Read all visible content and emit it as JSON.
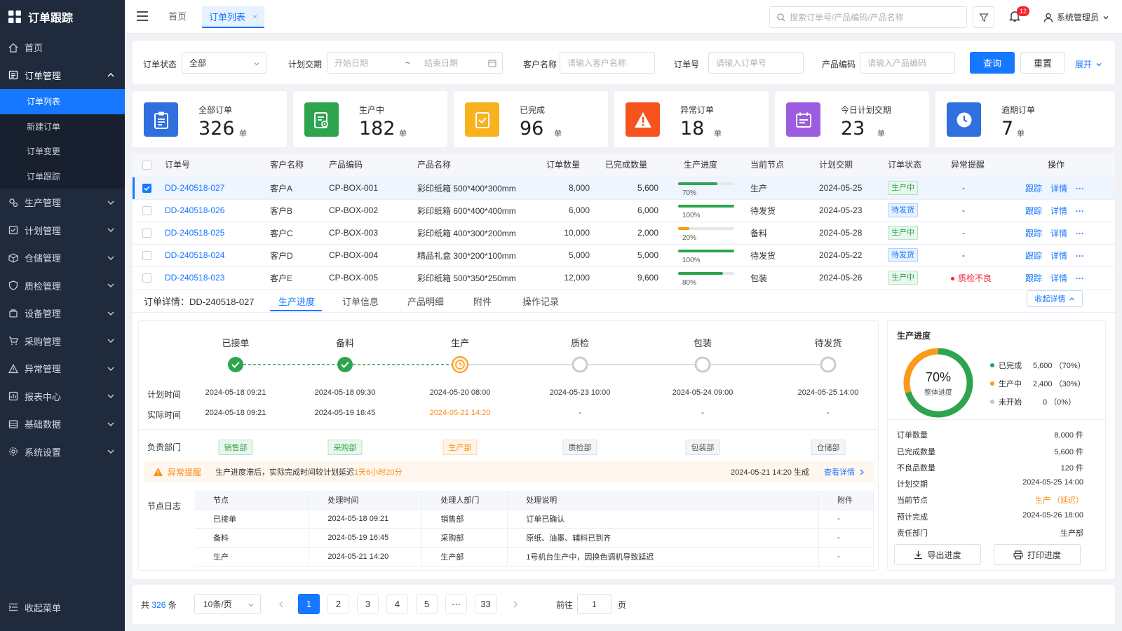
{
  "app": {
    "title": "订单跟踪",
    "collapse_menu": "收起菜单"
  },
  "sidebar": {
    "items": [
      {
        "label": "首页"
      },
      {
        "label": "订单管理"
      },
      {
        "label": "生产管理"
      },
      {
        "label": "计划管理"
      },
      {
        "label": "仓储管理"
      },
      {
        "label": "质检管理"
      },
      {
        "label": "设备管理"
      },
      {
        "label": "采购管理"
      },
      {
        "label": "异常管理"
      },
      {
        "label": "报表中心"
      },
      {
        "label": "基础数据"
      },
      {
        "label": "系统设置"
      }
    ],
    "subitems": [
      {
        "label": "订单列表"
      },
      {
        "label": "新建订单"
      },
      {
        "label": "订单变更"
      },
      {
        "label": "订单跟踪"
      }
    ]
  },
  "topbar": {
    "tab_home": "首页",
    "tab_active": "订单列表",
    "search_placeholder": "搜索订单号/产品编码/产品名称",
    "notif_count": "12",
    "user": "系统管理员"
  },
  "filters": {
    "status_label": "订单状态",
    "status_value": "全部",
    "date_label": "计划交期",
    "start_placeholder": "开始日期",
    "tilde": "~",
    "end_placeholder": "结束日期",
    "customer_label": "客户名称",
    "customer_placeholder": "请输入客户名称",
    "order_label": "订单号",
    "order_placeholder": "请输入订单号",
    "code_label": "产品编码",
    "code_placeholder": "请输入产品编码",
    "query": "查询",
    "reset": "重置",
    "expand": "展开"
  },
  "stats": [
    {
      "label": "全部订单",
      "value": "326",
      "unit": "单",
      "color": "#2f6fde"
    },
    {
      "label": "生产中",
      "value": "182",
      "unit": "单",
      "color": "#2ea44f"
    },
    {
      "label": "已完成",
      "value": "96",
      "unit": "单",
      "color": "#f7b21e"
    },
    {
      "label": "异常订单",
      "value": "18",
      "unit": "单",
      "color": "#f5541f"
    },
    {
      "label": "今日计划交期",
      "value": "23",
      "unit": "单",
      "color": "#9c5ce0"
    },
    {
      "label": "逾期订单",
      "value": "7",
      "unit": "单",
      "color": "#2f6fde"
    }
  ],
  "table": {
    "headers": [
      "订单号",
      "客户名称",
      "产品编码",
      "产品名称",
      "订单数量",
      "已完成数量",
      "生产进度",
      "当前节点",
      "计划交期",
      "订单状态",
      "异常提醒",
      "操作"
    ],
    "action_track": "跟踪",
    "action_detail": "详情",
    "action_more": "···",
    "rows": [
      {
        "id": "DD-240518-027",
        "customer": "客户A",
        "code": "CP-BOX-001",
        "name": "彩印纸箱 500*400*300mm",
        "qty": "8,000",
        "done": "5,600",
        "progress": 70,
        "progress_text": "70%",
        "node": "生产",
        "date": "2024-05-25",
        "status": "生产中",
        "alert": "-",
        "selected": true
      },
      {
        "id": "DD-240518-026",
        "customer": "客户B",
        "code": "CP-BOX-002",
        "name": "彩印纸箱 600*400*400mm",
        "qty": "6,000",
        "done": "6,000",
        "progress": 100,
        "progress_text": "100%",
        "node": "待发货",
        "date": "2024-05-23",
        "status": "待发货",
        "alert": "-",
        "selected": false
      },
      {
        "id": "DD-240518-025",
        "customer": "客户C",
        "code": "CP-BOX-003",
        "name": "彩印纸箱 400*300*200mm",
        "qty": "10,000",
        "done": "2,000",
        "progress": 20,
        "progress_text": "20%",
        "node": "备料",
        "date": "2024-05-28",
        "status": "生产中",
        "alert": "-",
        "selected": false
      },
      {
        "id": "DD-240518-024",
        "customer": "客户D",
        "code": "CP-BOX-004",
        "name": "精品礼盒 300*200*100mm",
        "qty": "5,000",
        "done": "5,000",
        "progress": 100,
        "progress_text": "100%",
        "node": "待发货",
        "date": "2024-05-22",
        "status": "待发货",
        "alert": "-",
        "selected": false
      },
      {
        "id": "DD-240518-023",
        "customer": "客户E",
        "code": "CP-BOX-005",
        "name": "彩印纸箱 500*350*250mm",
        "qty": "12,000",
        "done": "9,600",
        "progress": 80,
        "progress_text": "80%",
        "node": "包装",
        "date": "2024-05-26",
        "status": "生产中",
        "alert": "质检不良",
        "selected": false
      }
    ]
  },
  "detail": {
    "title": "订单详情：DD-240518-027",
    "tabs": [
      "生产进度",
      "订单信息",
      "产品明细",
      "附件",
      "操作记录"
    ],
    "collapse": "收起详情",
    "plan_label": "计划时间",
    "actual_label": "实际时间",
    "dept_label": "负责部门",
    "stages": [
      {
        "name": "已接单",
        "plan": "2024-05-18 09:21",
        "actual": "2024-05-18 09:21",
        "dept": "销售部",
        "state": "done"
      },
      {
        "name": "备料",
        "plan": "2024-05-18 09:30",
        "actual": "2024-05-19 16:45",
        "dept": "采购部",
        "state": "done"
      },
      {
        "name": "生产",
        "plan": "2024-05-20 08:00",
        "actual": "2024-05-21 14:20",
        "dept": "生产部",
        "state": "current"
      },
      {
        "name": "质检",
        "plan": "2024-05-23 10:00",
        "actual": "-",
        "dept": "质检部",
        "state": "todo"
      },
      {
        "name": "包装",
        "plan": "2024-05-24 09:00",
        "actual": "-",
        "dept": "包装部",
        "state": "todo"
      },
      {
        "name": "待发货",
        "plan": "2024-05-25 14:00",
        "actual": "-",
        "dept": "仓储部",
        "state": "todo"
      }
    ],
    "alert": {
      "label": "异常提醒",
      "text": "生产进度滞后，实际完成时间较计划延迟",
      "delay": "1天6小时20分",
      "time": "2024-05-21 14:20 生成",
      "link": "查看详情"
    },
    "log_label": "节点日志",
    "log_headers": [
      "节点",
      "处理时间",
      "处理人部门",
      "处理说明",
      "附件"
    ],
    "log_rows": [
      [
        "已接单",
        "2024-05-18 09:21",
        "销售部",
        "订单已确认",
        "-"
      ],
      [
        "备料",
        "2024-05-19 16:45",
        "采购部",
        "原纸、油墨、辅料已到齐",
        "-"
      ],
      [
        "生产",
        "2024-05-21 14:20",
        "生产部",
        "1号机台生产中，因换色调机导致延迟",
        "-"
      ]
    ]
  },
  "summary": {
    "title": "生产进度",
    "percent": "70%",
    "percent_label": "整体进度",
    "legend": [
      {
        "label": "已完成",
        "value": "5,600 （70%）",
        "color": "#2ea44f",
        "fraction": 0.7
      },
      {
        "label": "生产中",
        "value": "2,400 （30%）",
        "color": "#fa9a16",
        "fraction": 0.3
      },
      {
        "label": "未开始",
        "value": "0 （0%）",
        "color": "#c0c4cc",
        "fraction": 0
      }
    ],
    "info": [
      {
        "k": "订单数量",
        "v": "8,000   件"
      },
      {
        "k": "已完成数量",
        "v": "5,600   件"
      },
      {
        "k": "不良品数量",
        "v": "120   件"
      },
      {
        "k": "计划交期",
        "v": "2024-05-25 14:00"
      },
      {
        "k": "当前节点",
        "v": "生产 （延迟）",
        "warn": true
      },
      {
        "k": "预计完成",
        "v": "2024-05-26 18:00"
      },
      {
        "k": "责任部门",
        "v": "生产部"
      }
    ],
    "export": "导出进度",
    "print": "打印进度"
  },
  "pager": {
    "total_prefix": "共",
    "total": "326",
    "total_suffix": "条",
    "page_size": "10条/页",
    "pages": [
      "1",
      "2",
      "3",
      "4",
      "5",
      "···",
      "33"
    ],
    "goto_label": "前往",
    "goto_value": "1",
    "goto_suffix": "页"
  }
}
